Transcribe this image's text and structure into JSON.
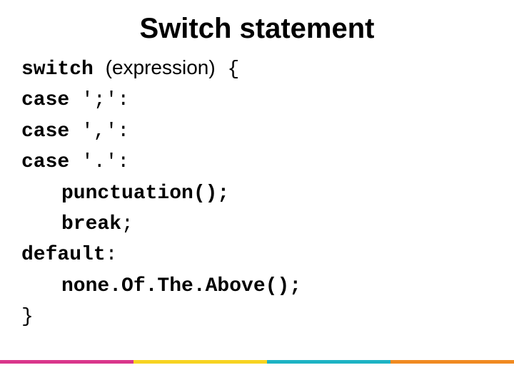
{
  "title": "Switch statement",
  "code": {
    "l1_kw": "switch",
    "l1_expr": "(expression)",
    "l1_brace": " {",
    "l2_kw": "case",
    "l2_rest": " ';':",
    "l3_kw": "case",
    "l3_rest": " ',':",
    "l4_kw": "case",
    "l4_rest": " '.':",
    "l5": "punctuation();",
    "l6_kw": "break",
    "l6_semi": ";",
    "l7_kw": "default",
    "l7_colon": ":",
    "l8": "none.Of.The.Above();",
    "l9": "}"
  }
}
